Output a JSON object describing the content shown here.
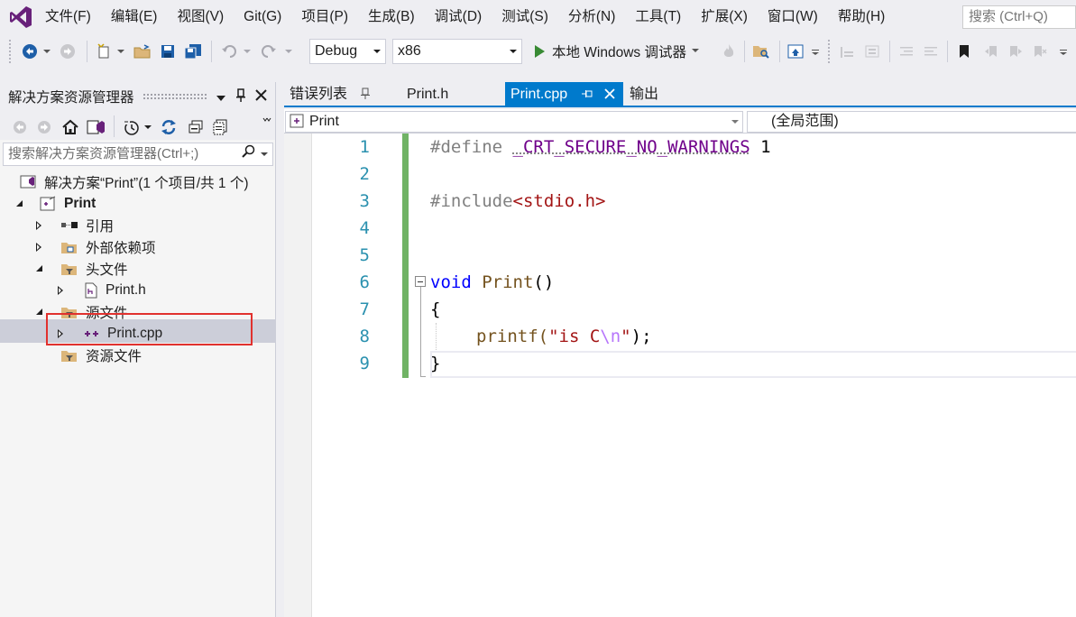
{
  "menu": [
    "文件(F)",
    "编辑(E)",
    "视图(V)",
    "Git(G)",
    "项目(P)",
    "生成(B)",
    "调试(D)",
    "测试(S)",
    "分析(N)",
    "工具(T)",
    "扩展(X)",
    "窗口(W)",
    "帮助(H)"
  ],
  "search_placeholder": "搜索 (Ctrl+Q)",
  "toolbar": {
    "config": "Debug",
    "platform": "x86",
    "run_label": "本地 Windows 调试器"
  },
  "solution_explorer": {
    "title": "解决方案资源管理器",
    "search_placeholder": "搜索解决方案资源管理器(Ctrl+;)",
    "tree": {
      "solution": "解决方案“Print”(1 个项目/共 1 个)",
      "project": "Print",
      "references": "引用",
      "external": "外部依赖项",
      "headers": "头文件",
      "header_file": "Print.h",
      "sources": "源文件",
      "source_file": "Print.cpp",
      "resources": "资源文件"
    }
  },
  "tabs": {
    "error_list": "错误列表",
    "print_h": "Print.h",
    "print_cpp": "Print.cpp",
    "output": "输出"
  },
  "navbar": {
    "scope": "Print",
    "member": "(全局范围)"
  },
  "editor": {
    "line_numbers": [
      "1",
      "2",
      "3",
      "4",
      "5",
      "6",
      "7",
      "8",
      "9"
    ],
    "code": {
      "l1_directive": "#define",
      "l1_macro": "_CRT_SECURE_NO_WARNINGS",
      "l1_value": "1",
      "l3_directive": "#include",
      "l3_header": "<stdio.h>",
      "l6_type": "void",
      "l6_name": "Print",
      "l6_parens": "()",
      "l7": "{",
      "l8_call": "printf(",
      "l8_str_a": "\"is C",
      "l8_esc": "\\n",
      "l8_str_b": "\"",
      "l8_end": ");",
      "l9": "}"
    }
  },
  "colors": {
    "accent": "#007acc",
    "highlight_box": "#e1312e",
    "change_bar": "#57a64a"
  }
}
